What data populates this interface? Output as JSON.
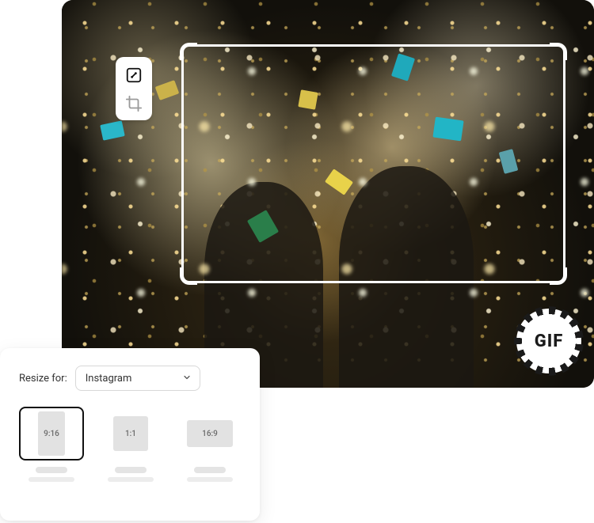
{
  "badge": {
    "gif_label": "GIF"
  },
  "tools": {
    "resize_icon": "resize-icon",
    "crop_icon": "crop-icon"
  },
  "resize_panel": {
    "label": "Resize for:",
    "dropdown_value": "Instagram",
    "ratios": [
      {
        "label": "9:16",
        "selected": true
      },
      {
        "label": "1:1",
        "selected": false
      },
      {
        "label": "16:9",
        "selected": false
      }
    ]
  }
}
